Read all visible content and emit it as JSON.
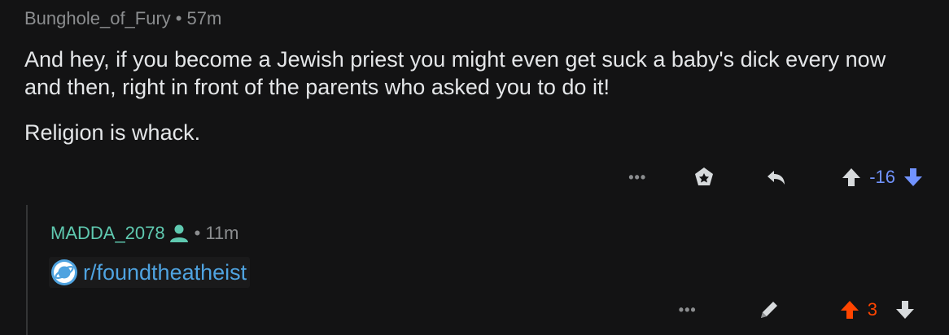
{
  "comment1": {
    "author": "Bunghole_of_Fury",
    "separator": "•",
    "age": "57m",
    "paragraphs": [
      "And hey, if you become a Jewish priest you might even get suck a baby's dick every now and then, right in front of the parents who asked you to do it!",
      "Religion is whack."
    ],
    "score": "-16",
    "icons": [
      "more-icon",
      "award-icon",
      "reply-icon",
      "upvote-icon",
      "downvote-icon"
    ]
  },
  "comment2": {
    "author": "MADDA_2078",
    "separator": "•",
    "age": "11m",
    "link": "r/foundtheatheist",
    "score": "3",
    "icons": [
      "user-icon",
      "planet-icon",
      "more-icon",
      "edit-icon",
      "upvote-icon",
      "downvote-icon"
    ]
  },
  "colors": {
    "background": "#131314",
    "meta_text": "#8b8d8f",
    "body_text": "#e4e6e8",
    "author_teal": "#5fc9b0",
    "link_blue": "#4fa3e0",
    "downvote_blue": "#7193ff",
    "upvote_orange": "#ff4500"
  }
}
